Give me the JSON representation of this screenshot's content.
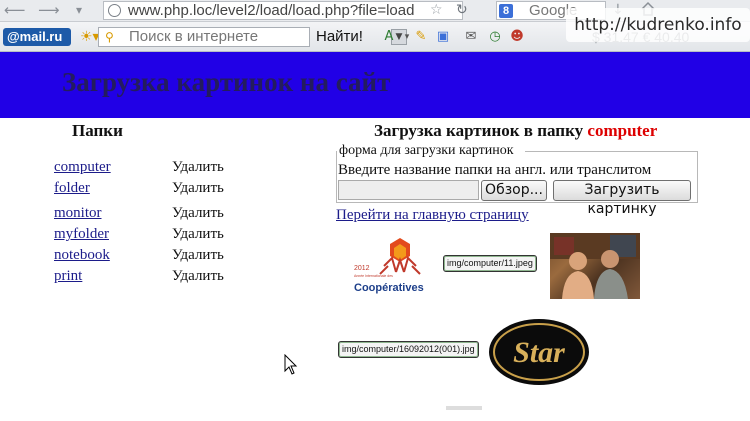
{
  "browser": {
    "url": "www.php.loc/level2/load/load.php?file=load",
    "search_engine_text": "Google",
    "mailru_logo": "@mail.ru",
    "mailru_search_placeholder": "Поиск в интернете",
    "find_button": "Найти!",
    "currency_text": "$ 31.47  € 40.40",
    "watermark": "http://kudrenko.info",
    "icons": [
      "back-arrow-icon",
      "forward-arrow-icon",
      "globe-icon",
      "star-icon",
      "reload-icon",
      "google-icon",
      "download-icon",
      "home-icon"
    ]
  },
  "page": {
    "banner_title": "Загрузка картинок на сайт",
    "folders_title": "Папки",
    "folders": [
      {
        "name": "computer",
        "delete": "Удалить"
      },
      {
        "name": "folder",
        "delete": "Удалить"
      },
      {
        "name": "monitor",
        "delete": "Удалить"
      },
      {
        "name": "myfolder",
        "delete": "Удалить"
      },
      {
        "name": "notebook",
        "delete": "Удалить"
      },
      {
        "name": "print",
        "delete": "Удалить"
      }
    ],
    "upload_title_prefix": "Загрузка картинок в папку",
    "upload_folder": "computer",
    "form_legend": "форма для загрузки картинок",
    "instruction": "Введите название папки на англ. или транслитом",
    "browse_button": "Обзор...",
    "upload_button": "Загрузить картинку",
    "home_link": "Перейти на главную страницу",
    "images": [
      {
        "label": "img/computer/11.jpeg"
      },
      {
        "label": "img/computer/16092012(001).jpg"
      }
    ],
    "coop_logo": {
      "year": "2012",
      "caption": "Coopératives",
      "small": "Année Internationale des"
    },
    "star_logo_text": "Star",
    "colors": {
      "banner": "#2100e6",
      "banner_text": "#241c5e",
      "link": "#1c1c8a",
      "folder_highlight": "#dd0000"
    }
  }
}
